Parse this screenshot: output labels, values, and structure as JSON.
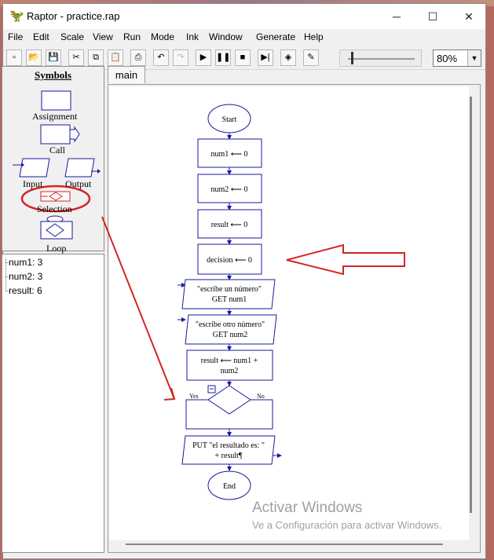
{
  "window": {
    "title": "Raptor - practice.rap",
    "app_icon": "raptor-icon",
    "minimize": "─",
    "maximize": "☐",
    "close": "✕"
  },
  "menu": [
    "File",
    "Edit",
    "Scale",
    "View",
    "Run",
    "Mode",
    "Ink",
    "Window",
    "Generate",
    "Help"
  ],
  "toolbar": {
    "buttons": [
      "new-icon",
      "open-icon",
      "save-icon",
      "cut-icon",
      "copy-icon",
      "paste-icon",
      "print-icon",
      "undo-icon",
      "redo-icon",
      "play-icon",
      "pause-icon",
      "stop-icon",
      "step-icon",
      "test-icon",
      "pen-icon"
    ],
    "slider_fraction": 0.05,
    "zoom": "80%"
  },
  "symbols": {
    "title": "Symbols",
    "items": [
      "Assignment",
      "Call",
      "Input",
      "Output",
      "Selection",
      "Loop"
    ]
  },
  "variables": [
    "num1: 3",
    "num2: 3",
    "result: 6"
  ],
  "tab": "main",
  "flowchart": {
    "start": "Start",
    "assign1": "num1 ⟵ 0",
    "assign2": "num2 ⟵ 0",
    "assign3": "result ⟵ 0",
    "assign4": "decision ⟵ 0",
    "input1_prompt": "\"escribe un número\"",
    "input1_var": "GET num1",
    "input2_prompt": "\"escribe otro número\"",
    "input2_var": "GET num2",
    "calc_line1": "result ⟵ num1 +",
    "calc_line2": "num2",
    "yes": "Yes",
    "no": "No",
    "output_line1": "PUT \"el resultado es: \"",
    "output_line2": "+ result¶",
    "end": "End"
  },
  "watermark": {
    "line1": "Activar Windows",
    "line2": "Ve a Configuración para activar Windows."
  },
  "colors": {
    "flowchart_blue": "#1a1a9c",
    "annotation_red": "#d32525"
  }
}
